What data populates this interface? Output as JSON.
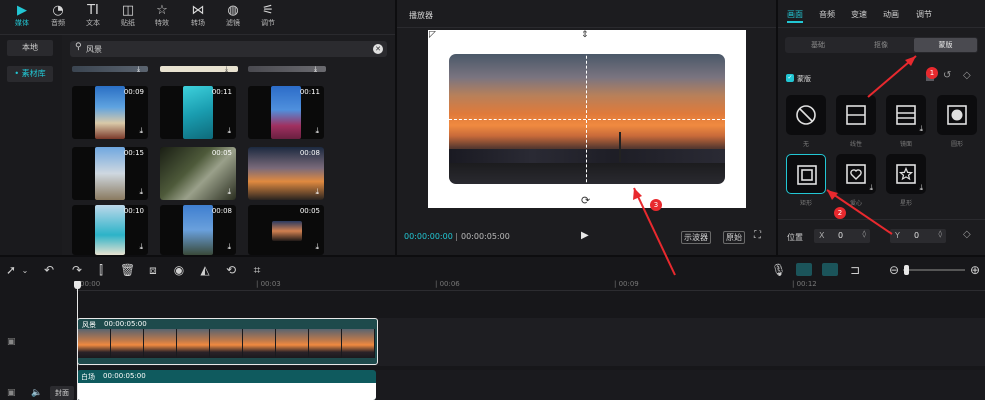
{
  "top_toolbar": {
    "items": [
      {
        "label": "媒体",
        "icon": "media-icon",
        "glyph": "▶"
      },
      {
        "label": "音频",
        "icon": "audio-icon",
        "glyph": "◔"
      },
      {
        "label": "文本",
        "icon": "text-icon",
        "glyph": "TI"
      },
      {
        "label": "贴纸",
        "icon": "sticker-icon",
        "glyph": "◫"
      },
      {
        "label": "特效",
        "icon": "effects-icon",
        "glyph": "☆"
      },
      {
        "label": "转场",
        "icon": "transition-icon",
        "glyph": "⋈"
      },
      {
        "label": "滤镜",
        "icon": "filter-icon",
        "glyph": "◍"
      },
      {
        "label": "调节",
        "icon": "adjust-icon",
        "glyph": "⚟"
      }
    ]
  },
  "media_sidebar": {
    "local": "本地",
    "library": "• 素材库"
  },
  "search": {
    "value": "风景"
  },
  "thumbnails": [
    {
      "duration": "00:09"
    },
    {
      "duration": "00:11"
    },
    {
      "duration": "00:11"
    },
    {
      "duration": "00:15"
    },
    {
      "duration": "00:05"
    },
    {
      "duration": "00:08"
    },
    {
      "duration": "00:10"
    },
    {
      "duration": "00:08"
    },
    {
      "duration": "00:05"
    }
  ],
  "player": {
    "title": "播放器",
    "current_time": "00:00:00:00",
    "total_time": "00:00:05:00",
    "oscilloscope_btn": "示波器",
    "original_btn": "原始"
  },
  "inspector": {
    "tabs": [
      "画面",
      "音频",
      "变速",
      "动画",
      "调节"
    ],
    "active_tab": "画面",
    "segments": [
      "基础",
      "抠像",
      "蒙版"
    ],
    "active_segment": "蒙版",
    "mask_title": "蒙版",
    "masks": [
      {
        "label": "无",
        "icon": "none-mask-icon"
      },
      {
        "label": "线性",
        "icon": "linear-mask-icon"
      },
      {
        "label": "镜面",
        "icon": "mirror-mask-icon"
      },
      {
        "label": "圆形",
        "icon": "circle-mask-icon"
      },
      {
        "label": "矩形",
        "icon": "rectangle-mask-icon"
      },
      {
        "label": "爱心",
        "icon": "heart-mask-icon"
      },
      {
        "label": "星形",
        "icon": "star-mask-icon"
      }
    ],
    "selected_mask": "矩形",
    "position": {
      "label": "位置",
      "x_label": "X",
      "x_value": "0",
      "y_label": "Y",
      "y_value": "0"
    }
  },
  "annotations": [
    "1",
    "2",
    "3"
  ],
  "timeline": {
    "ruler": [
      "00:00",
      "| 00:03",
      "| 00:06",
      "| 00:09",
      "| 00:12"
    ],
    "tracks": [
      {
        "name": "风景",
        "duration": "00:00:05:00"
      },
      {
        "name": "白场",
        "duration": "00:00:05:00"
      }
    ],
    "cover_label": "封面"
  },
  "colors": {
    "accent": "#22c7d4",
    "annotation_red": "#e8292e",
    "clip_bg": "#1e4a4c",
    "clip2_bg": "#0f5a5e"
  }
}
